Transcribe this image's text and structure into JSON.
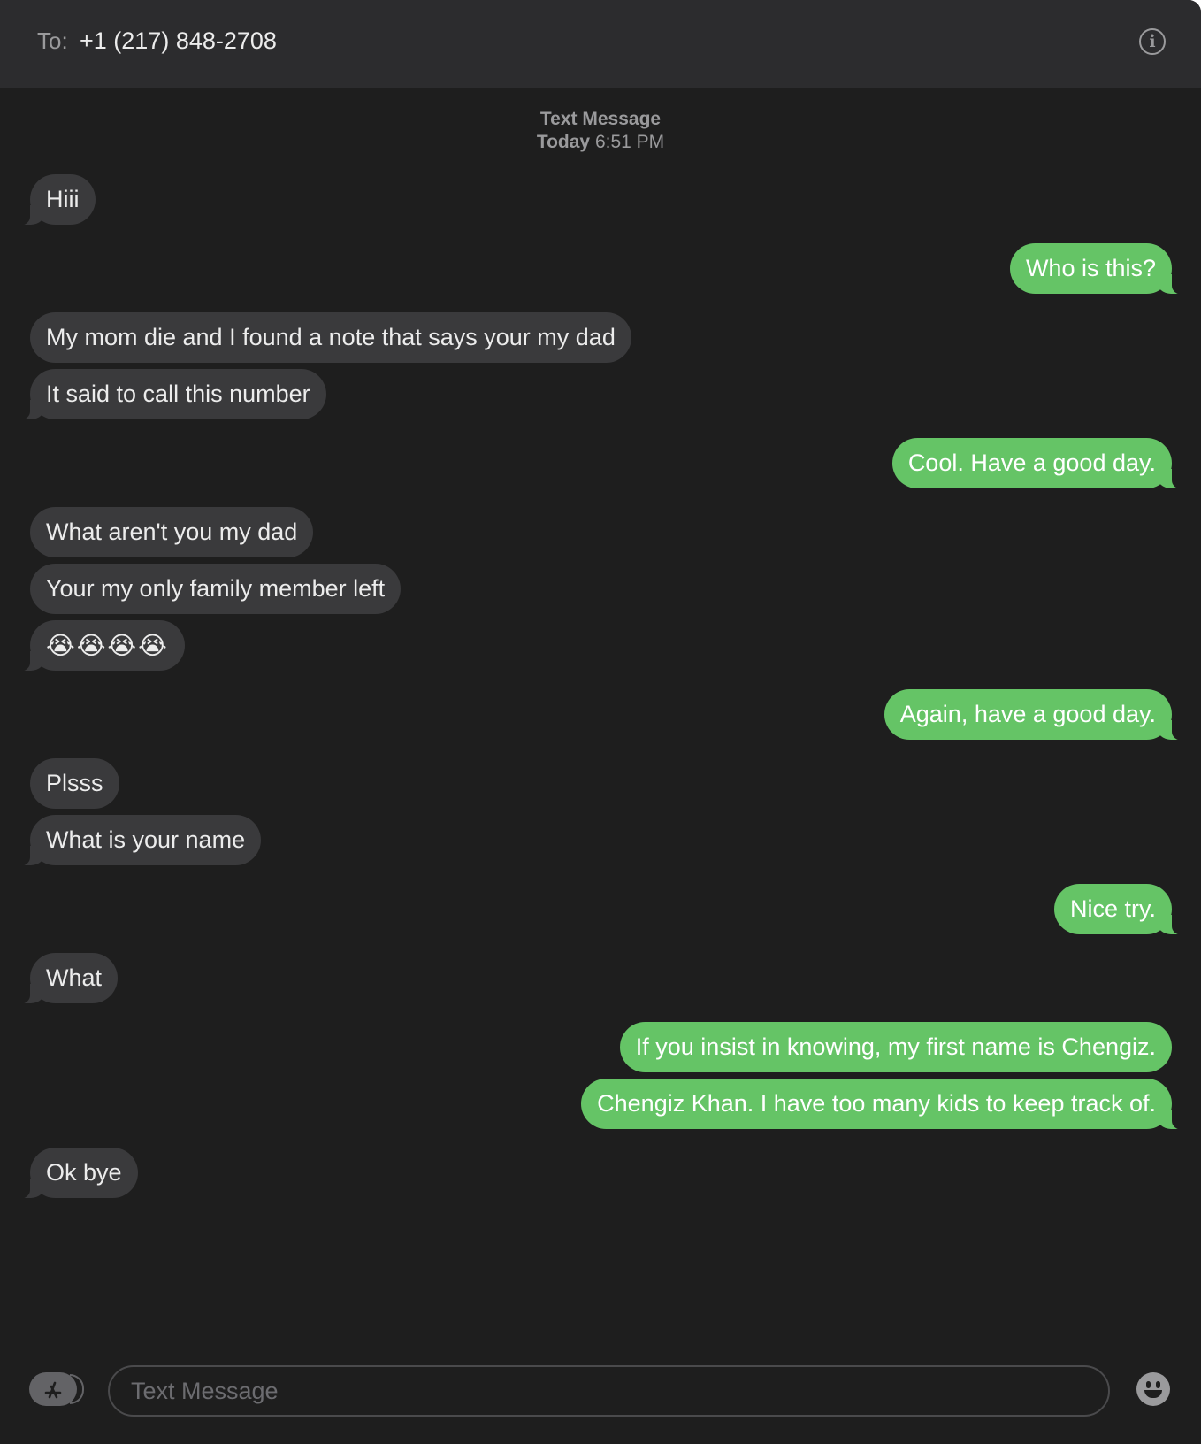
{
  "header": {
    "to_label": "To:",
    "recipient": "+1 (217) 848-2708",
    "info_icon": "info-icon"
  },
  "conversation": {
    "service": "Text Message",
    "time_day": "Today",
    "time_clock": "6:51 PM",
    "messages": [
      {
        "direction": "incoming",
        "text": "Hiii"
      },
      {
        "direction": "outgoing",
        "text": "Who is this?"
      },
      {
        "direction": "incoming",
        "text": "My mom die and I found a note that says your my dad"
      },
      {
        "direction": "incoming",
        "text": "It said to call this number"
      },
      {
        "direction": "outgoing",
        "text": "Cool. Have a good day."
      },
      {
        "direction": "incoming",
        "text": "What aren't you my dad"
      },
      {
        "direction": "incoming",
        "text": "Your my only family member left"
      },
      {
        "direction": "incoming",
        "text": "😭😭😭😭"
      },
      {
        "direction": "outgoing",
        "text": "Again, have a good day."
      },
      {
        "direction": "incoming",
        "text": "Plsss"
      },
      {
        "direction": "incoming",
        "text": "What is your name"
      },
      {
        "direction": "outgoing",
        "text": "Nice try."
      },
      {
        "direction": "incoming",
        "text": "What"
      },
      {
        "direction": "outgoing",
        "text": "If you insist in knowing, my first name is Chengiz."
      },
      {
        "direction": "outgoing",
        "text": "Chengiz Khan. I have too many kids to keep track of."
      },
      {
        "direction": "incoming",
        "text": "Ok bye"
      }
    ]
  },
  "compose": {
    "placeholder": "Text Message",
    "value": "",
    "apps_icon": "app-store-icon",
    "emoji_icon": "emoji-icon"
  },
  "colors": {
    "incoming_bubble": "#3a3a3c",
    "outgoing_bubble": "#65c466",
    "background": "#1e1e1e",
    "header": "#2c2c2e"
  }
}
